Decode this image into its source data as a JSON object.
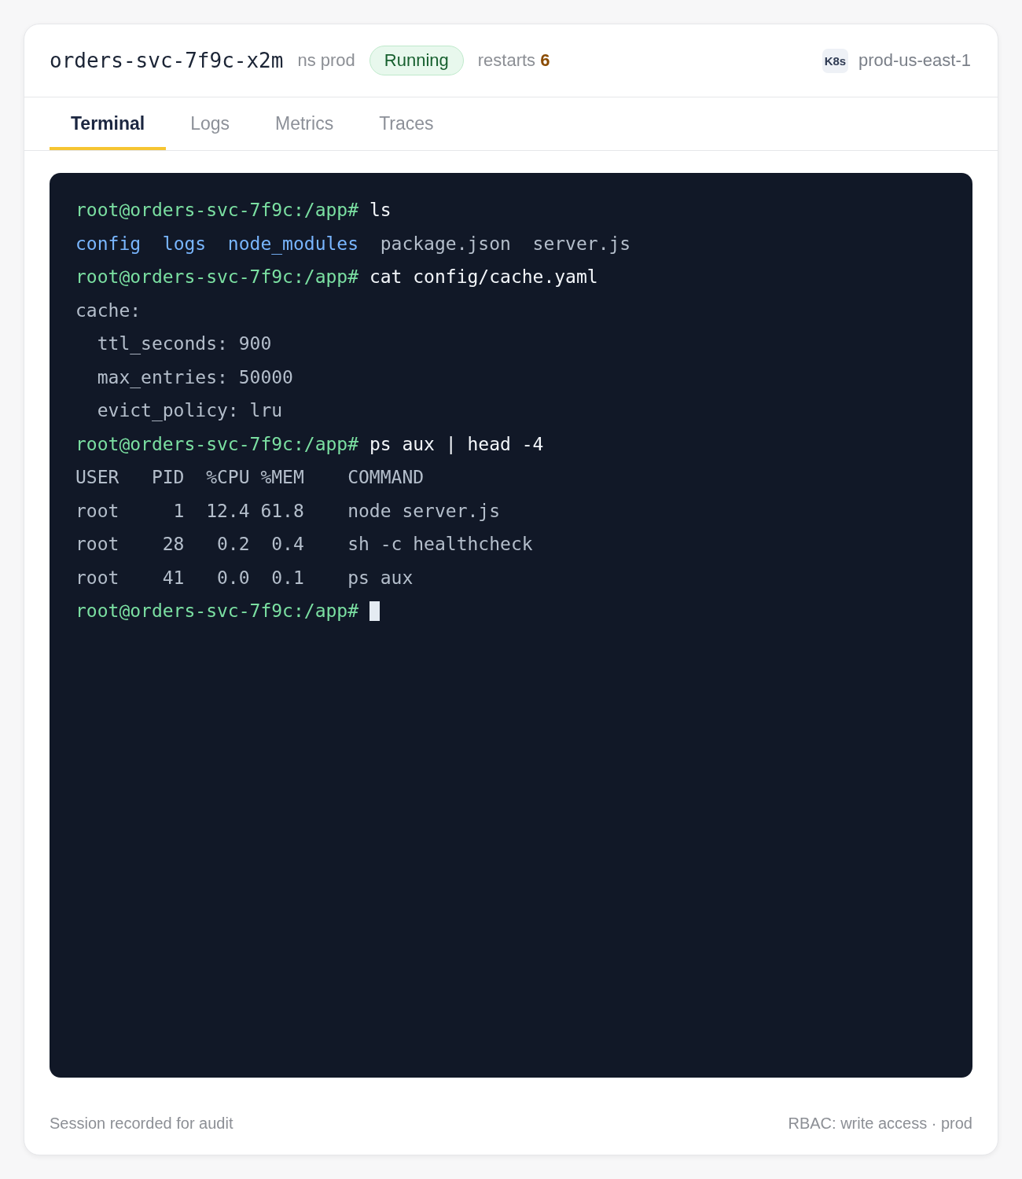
{
  "pod": {
    "name": "orders-svc-7f9c-x2m",
    "namespace": "ns prod",
    "status": {
      "label": "Running",
      "kind": "running"
    },
    "restarts": {
      "label": "restarts",
      "count": "6"
    }
  },
  "cluster": {
    "badge": "K8s",
    "name": "prod-us-east-1"
  },
  "tabs": [
    {
      "label": "Terminal",
      "selected": true
    },
    {
      "label": "Logs",
      "selected": false
    },
    {
      "label": "Metrics",
      "selected": false
    },
    {
      "label": "Traces",
      "selected": false
    }
  ],
  "terminal": {
    "lines": [
      {
        "kind": "input",
        "prompt": "root@orders-svc-7f9c:/app#",
        "command": "ls"
      },
      {
        "kind": "listing",
        "entries": [
          {
            "name": "config",
            "kind": "dir"
          },
          {
            "name": "logs",
            "kind": "dir"
          },
          {
            "name": "node_modules",
            "kind": "dir"
          },
          {
            "name": "package.json",
            "kind": "file"
          },
          {
            "name": "server.js",
            "kind": "file"
          }
        ]
      },
      {
        "kind": "input",
        "prompt": "root@orders-svc-7f9c:/app#",
        "command": "cat config/cache.yaml"
      },
      {
        "kind": "output",
        "text": "cache:",
        "children": [
          {
            "text": "ttl_seconds: 900"
          },
          {
            "text": "max_entries: 50000"
          },
          {
            "text": "evict_policy: lru"
          }
        ]
      },
      {
        "kind": "input",
        "prompt": "root@orders-svc-7f9c:/app#",
        "command": "ps aux | head -4"
      },
      {
        "kind": "output",
        "text": "USER   PID  %CPU %MEM    COMMAND"
      },
      {
        "kind": "output",
        "text": "root     1  12.4 61.8    node server.js"
      },
      {
        "kind": "output",
        "text": "root    28   0.2  0.4    sh -c healthcheck"
      },
      {
        "kind": "output",
        "text": "root    41   0.0  0.1    ps aux"
      },
      {
        "kind": "input",
        "prompt": "root@orders-svc-7f9c:/app#",
        "cursor": true
      }
    ]
  },
  "footer": {
    "left": "Session recorded for audit",
    "right": "RBAC: write access · prod"
  }
}
